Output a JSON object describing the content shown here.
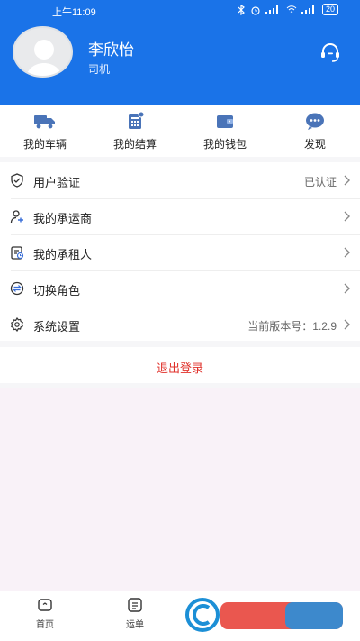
{
  "status_bar": {
    "time": "上午11:09",
    "battery": "20"
  },
  "profile": {
    "name": "李欣怡",
    "role": "司机"
  },
  "quick_actions": [
    {
      "label": "我的车辆",
      "icon": "truck-icon"
    },
    {
      "label": "我的结算",
      "icon": "settlement-icon"
    },
    {
      "label": "我的钱包",
      "icon": "wallet-icon"
    },
    {
      "label": "发现",
      "icon": "chat-bubble-icon"
    }
  ],
  "menu": [
    {
      "label": "用户验证",
      "value": "已认证",
      "icon": "shield-icon"
    },
    {
      "label": "我的承运商",
      "value": "",
      "icon": "person-icon"
    },
    {
      "label": "我的承租人",
      "value": "",
      "icon": "document-icon"
    },
    {
      "label": "切换角色",
      "value": "",
      "icon": "switch-icon"
    },
    {
      "label": "系统设置",
      "value": "当前版本号：1.2.9",
      "icon": "gear-icon"
    }
  ],
  "logout_label": "退出登录",
  "tabs": [
    {
      "label": "首页",
      "icon": "home-icon"
    },
    {
      "label": "运单",
      "icon": "waybill-icon"
    }
  ],
  "colors": {
    "brand": "#1a73e8",
    "danger": "#e0312b"
  }
}
